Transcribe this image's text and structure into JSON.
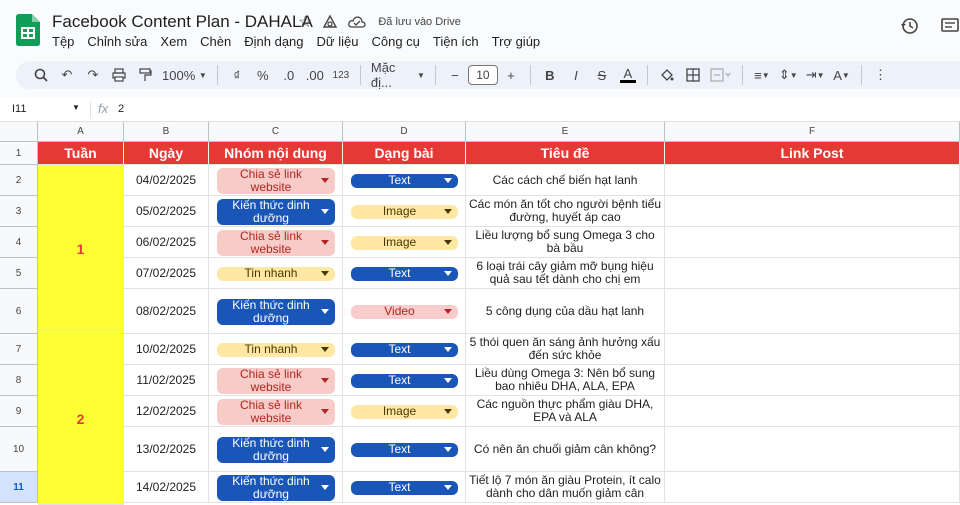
{
  "app": {
    "title": "Facebook Content Plan - DAHALA",
    "saved_status": "Đã lưu vào Drive",
    "menu": [
      "Tệp",
      "Chỉnh sửa",
      "Xem",
      "Chèn",
      "Định dạng",
      "Dữ liệu",
      "Công cụ",
      "Tiện ích",
      "Trợ giúp"
    ]
  },
  "toolbar": {
    "zoom": "100%",
    "currency": "₫",
    "percent": "%",
    "dec_decrease": ".0",
    "dec_increase": ".00",
    "number_format": "123",
    "font": "Mặc đị...",
    "font_size": "10",
    "minus": "−",
    "plus": "+",
    "bold": "B",
    "italic": "I",
    "strike": "S",
    "textcolor": "A"
  },
  "formula_bar": {
    "cell_ref": "I11",
    "fx": "fx",
    "value": "2"
  },
  "columns": [
    "A",
    "B",
    "C",
    "D",
    "E",
    "F"
  ],
  "row_numbers": [
    "1",
    "2",
    "3",
    "4",
    "5",
    "6",
    "7",
    "8",
    "9",
    "10",
    "11"
  ],
  "headers": [
    "Tuần",
    "Ngày",
    "Nhóm nội dung",
    "Dạng bài",
    "Tiêu đề",
    "Link Post"
  ],
  "weeks": [
    "1",
    "2"
  ],
  "rows": [
    {
      "date": "04/02/2025",
      "group": "Chia sẻ link website",
      "type": "Text",
      "title": "Các cách chế biến hạt lanh"
    },
    {
      "date": "05/02/2025",
      "group": "Kiến thức dinh dưỡng",
      "type": "Image",
      "title": "Các món ăn tốt cho người bệnh tiểu đường, huyết áp cao"
    },
    {
      "date": "06/02/2025",
      "group": "Chia sẻ link website",
      "type": "Image",
      "title": "Liều lượng bổ sung Omega 3 cho bà bầu"
    },
    {
      "date": "07/02/2025",
      "group": "Tin nhanh",
      "type": "Text",
      "title": "6 loại trái cây giảm mỡ bụng hiệu quả sau tết dành cho chị em"
    },
    {
      "date": "08/02/2025",
      "group": "Kiến thức dinh dưỡng",
      "type": "Video",
      "title": "5 công dụng của dầu hạt lanh"
    },
    {
      "date": "10/02/2025",
      "group": "Tin nhanh",
      "type": "Text",
      "title": "5 thói quen ăn sáng ảnh hưởng xấu đến sức khỏe"
    },
    {
      "date": "11/02/2025",
      "group": "Chia sẻ link website",
      "type": "Text",
      "title": "Liều dùng Omega 3: Nên bổ sung bao nhiêu DHA, ALA, EPA"
    },
    {
      "date": "12/02/2025",
      "group": "Chia sẻ link website",
      "type": "Image",
      "title": "Các nguồn thực phẩm giàu DHA, EPA và ALA"
    },
    {
      "date": "13/02/2025",
      "group": "Kiến thức dinh dưỡng",
      "type": "Text",
      "title": "Có nên ăn chuối giảm cân không?"
    },
    {
      "date": "14/02/2025",
      "group": "Kiến thức dinh dưỡng",
      "type": "Text",
      "title": "Tiết lộ 7 món ăn giàu Protein, ít calo dành cho dân muốn giảm cân"
    }
  ],
  "colors": {
    "header_red": "#e53935",
    "week_yellow": "#ffff33",
    "chip_blue": "#1a56b7",
    "chip_pink": "#f7cbc8",
    "chip_yellow": "#ffe8a3"
  }
}
